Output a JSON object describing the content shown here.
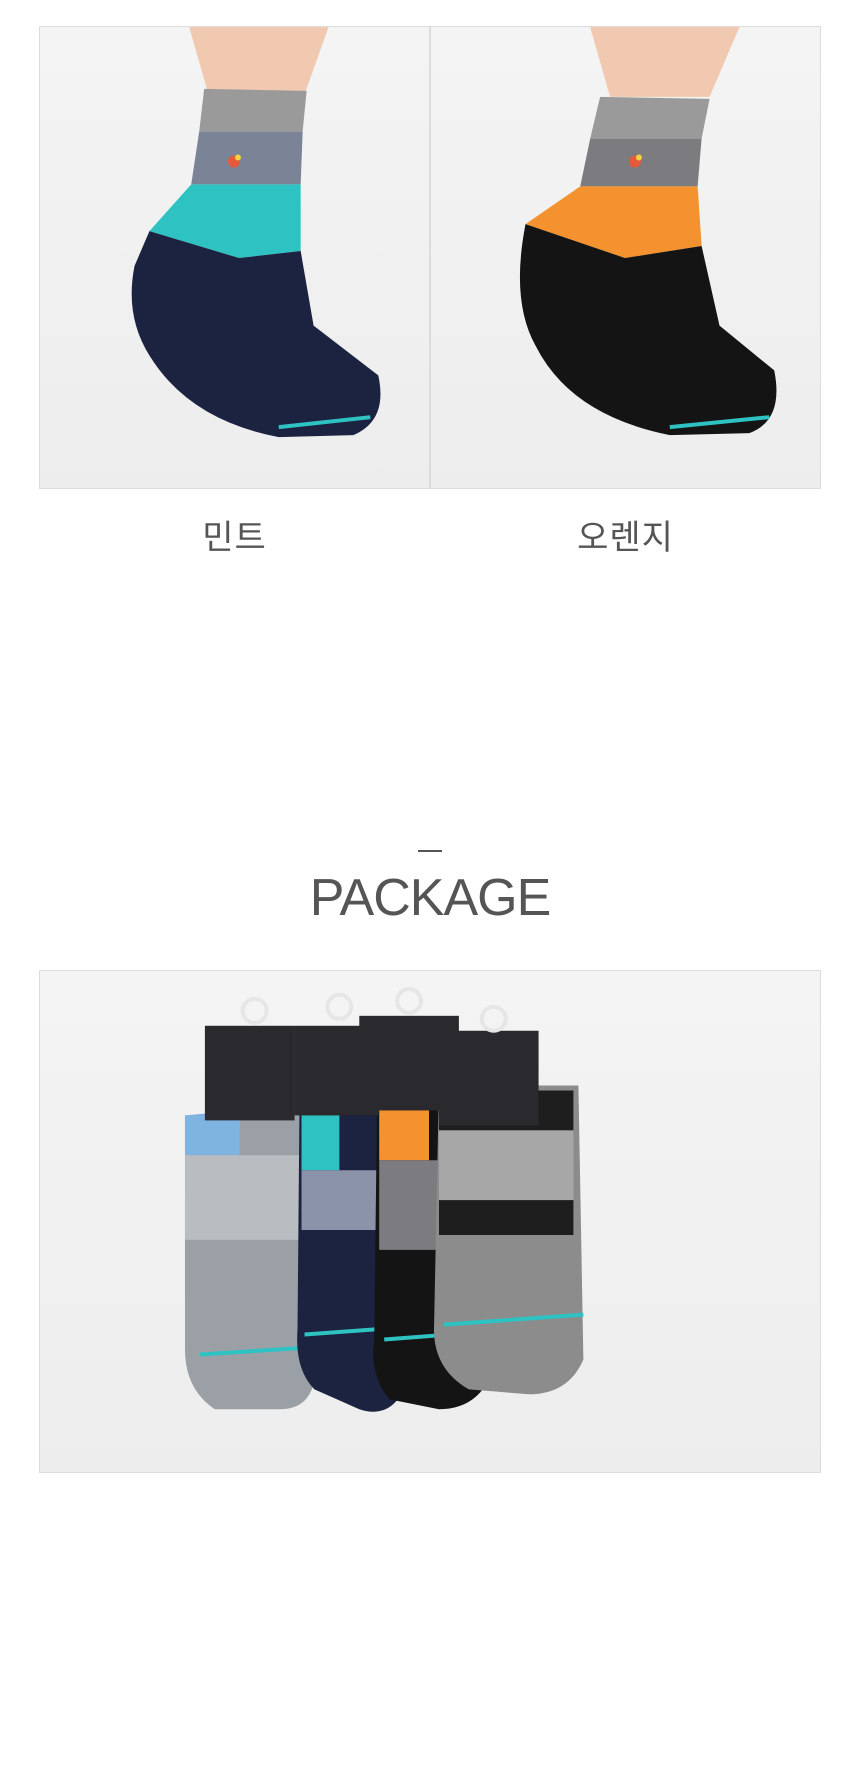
{
  "products": [
    {
      "caption": "민트",
      "accent": "#2ec2c2",
      "body": "#1c2340"
    },
    {
      "caption": "오렌지",
      "accent": "#f4922f",
      "body": "#141414"
    }
  ],
  "section": {
    "dash": "—",
    "title": "PACKAGE"
  },
  "package": {
    "sock_colors": [
      "#9aa0a6",
      "#1c2340",
      "#141414",
      "#8c8c8c"
    ],
    "accents": [
      "#7fb3e0",
      "#2ec2c2",
      "#f4922f",
      "#1e1e1e"
    ],
    "card_color": "#2a2a2e"
  }
}
